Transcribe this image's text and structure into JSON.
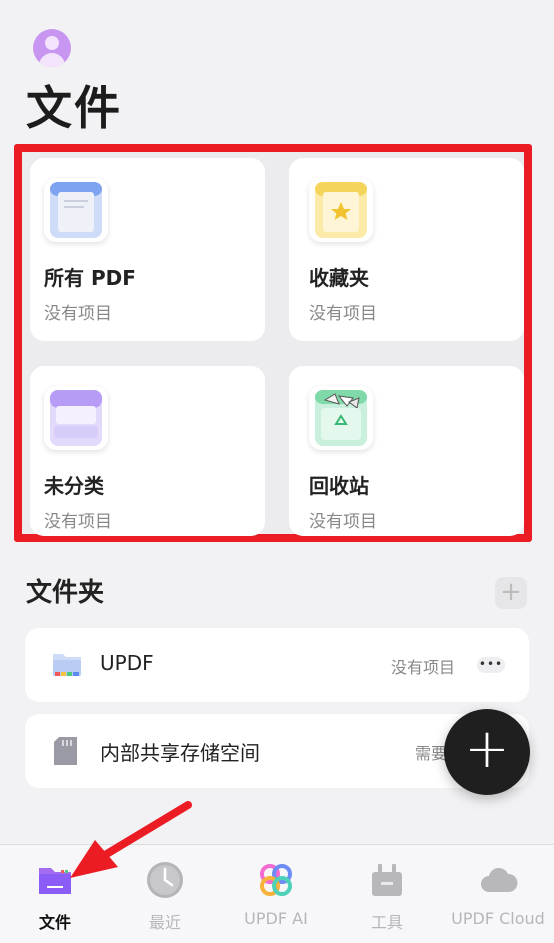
{
  "header": {
    "title": "文件"
  },
  "cards": [
    {
      "label": "所有 PDF",
      "sub": "没有项目",
      "icon": "all-pdf-icon"
    },
    {
      "label": "收藏夹",
      "sub": "没有项目",
      "icon": "favorites-icon"
    },
    {
      "label": "未分类",
      "sub": "没有项目",
      "icon": "uncategorized-icon"
    },
    {
      "label": "回收站",
      "sub": "没有项目",
      "icon": "recycle-bin-icon"
    }
  ],
  "folders": {
    "title": "文件夹",
    "add_label": "+",
    "items": [
      {
        "label": "UPDF",
        "value": "没有项目",
        "more": "•••",
        "icon": "folder-icon"
      },
      {
        "label": "内部共享存储空间",
        "value": "需要权限",
        "icon": "sd-card-icon"
      }
    ]
  },
  "fab": {
    "label": "+"
  },
  "tabs": [
    {
      "label": "文件",
      "active": true,
      "icon": "folder-icon"
    },
    {
      "label": "最近",
      "icon": "clock-icon"
    },
    {
      "label": "UPDF AI",
      "icon": "ai-icon"
    },
    {
      "label": "工具",
      "icon": "toolbox-icon"
    },
    {
      "label": "UPDF Cloud",
      "icon": "cloud-icon"
    }
  ],
  "colors": {
    "highlight": "#ec1c24",
    "accent": "#8b5cf6",
    "background": "#f2f2f4"
  }
}
